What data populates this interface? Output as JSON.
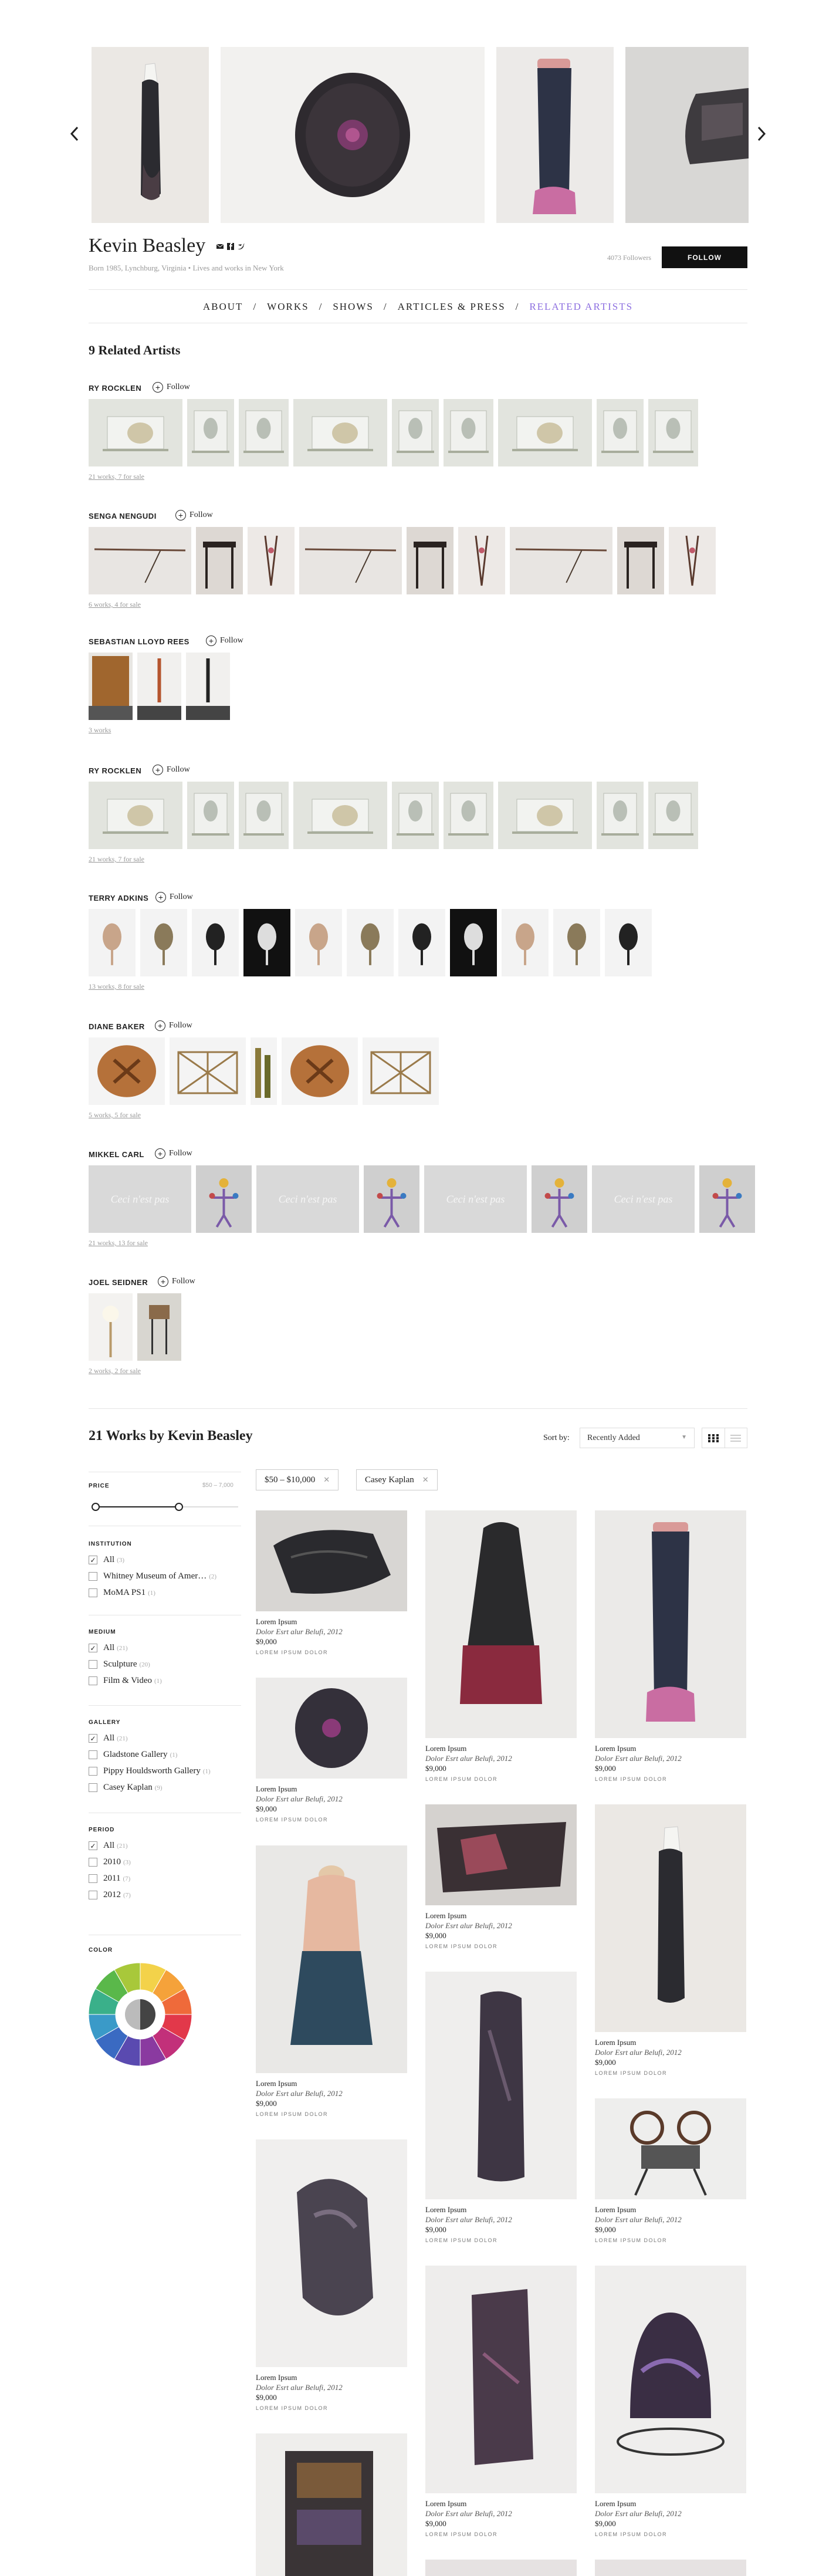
{
  "colors": {
    "accent": "#8c6ee0",
    "button": "#111111",
    "muted": "#999999"
  },
  "artist": {
    "name": "Kevin Beasley",
    "subline": "Born 1985, Lynchburg, Virginia • Lives and works in New York",
    "followers": "4073 Followers",
    "follow_label": "FOLLOW",
    "social_icons": [
      "email-icon",
      "facebook-icon",
      "twitter-icon"
    ]
  },
  "nav": {
    "items": [
      "ABOUT",
      "WORKS",
      "SHOWS",
      "ARTICLES & PRESS",
      "RELATED ARTISTS"
    ],
    "separator": "/",
    "active": "RELATED ARTISTS"
  },
  "related": {
    "title": "9 Related Artists",
    "follow_label": "Follow",
    "artists": [
      {
        "name": "RY ROCKLEN",
        "count": "21 works, 7 for sale"
      },
      {
        "name": "SENGA NENGUDI",
        "count": "6 works, 4 for sale"
      },
      {
        "name": "SEBASTIAN LLOYD REES",
        "count": "3 works"
      },
      {
        "name": "RY ROCKLEN",
        "count": "21 works, 7 for sale"
      },
      {
        "name": "TERRY ADKINS",
        "count": "13 works, 8 for sale"
      },
      {
        "name": "DIANE BAKER",
        "count": "5 works, 5 for sale"
      },
      {
        "name": "MIKKEL CARL",
        "count": "21 works, 13 for sale"
      },
      {
        "name": "JOEL SEIDNER",
        "count": "2 works, 2 for sale"
      }
    ]
  },
  "works": {
    "title": "21 Works by Kevin Beasley",
    "sort_label": "Sort by:",
    "sort_value": "Recently Added",
    "chips": [
      "$50 – $10,000",
      "Casey Kaplan"
    ],
    "card": {
      "title": "Lorem Ipsum",
      "subtitle": "Dolor Esrt alur Belufi, 2012",
      "price": "$9,000",
      "link": "LOREM IPSUM DOLOR"
    }
  },
  "filters": {
    "price": {
      "heading": "PRICE",
      "range": "$50 – 7,000",
      "value_fraction_low": 0.0,
      "value_fraction_high": 0.6
    },
    "institution": {
      "heading": "INSTITUTION",
      "options": [
        {
          "label": "All",
          "count": "(3)",
          "checked": true
        },
        {
          "label": "Whitney Museum of Amer…",
          "count": "(2)",
          "checked": false
        },
        {
          "label": "MoMA PS1",
          "count": "(1)",
          "checked": false
        }
      ]
    },
    "medium": {
      "heading": "MEDIUM",
      "options": [
        {
          "label": "All",
          "count": "(21)",
          "checked": true
        },
        {
          "label": "Sculpture",
          "count": "(20)",
          "checked": false
        },
        {
          "label": "Film & Video",
          "count": "(1)",
          "checked": false
        }
      ]
    },
    "gallery": {
      "heading": "GALLERY",
      "options": [
        {
          "label": "All",
          "count": "(21)",
          "checked": true
        },
        {
          "label": "Gladstone Gallery",
          "count": "(1)",
          "checked": false
        },
        {
          "label": "Pippy Houldsworth Gallery",
          "count": "(1)",
          "checked": false
        },
        {
          "label": "Casey Kaplan",
          "count": "(9)",
          "checked": false
        }
      ]
    },
    "period": {
      "heading": "PERIOD",
      "options": [
        {
          "label": "All",
          "count": "(21)",
          "checked": true
        },
        {
          "label": "2010",
          "count": "(3)",
          "checked": false
        },
        {
          "label": "2011",
          "count": "(7)",
          "checked": false
        },
        {
          "label": "2012",
          "count": "(7)",
          "checked": false
        }
      ]
    },
    "color": {
      "heading": "COLOR"
    }
  }
}
